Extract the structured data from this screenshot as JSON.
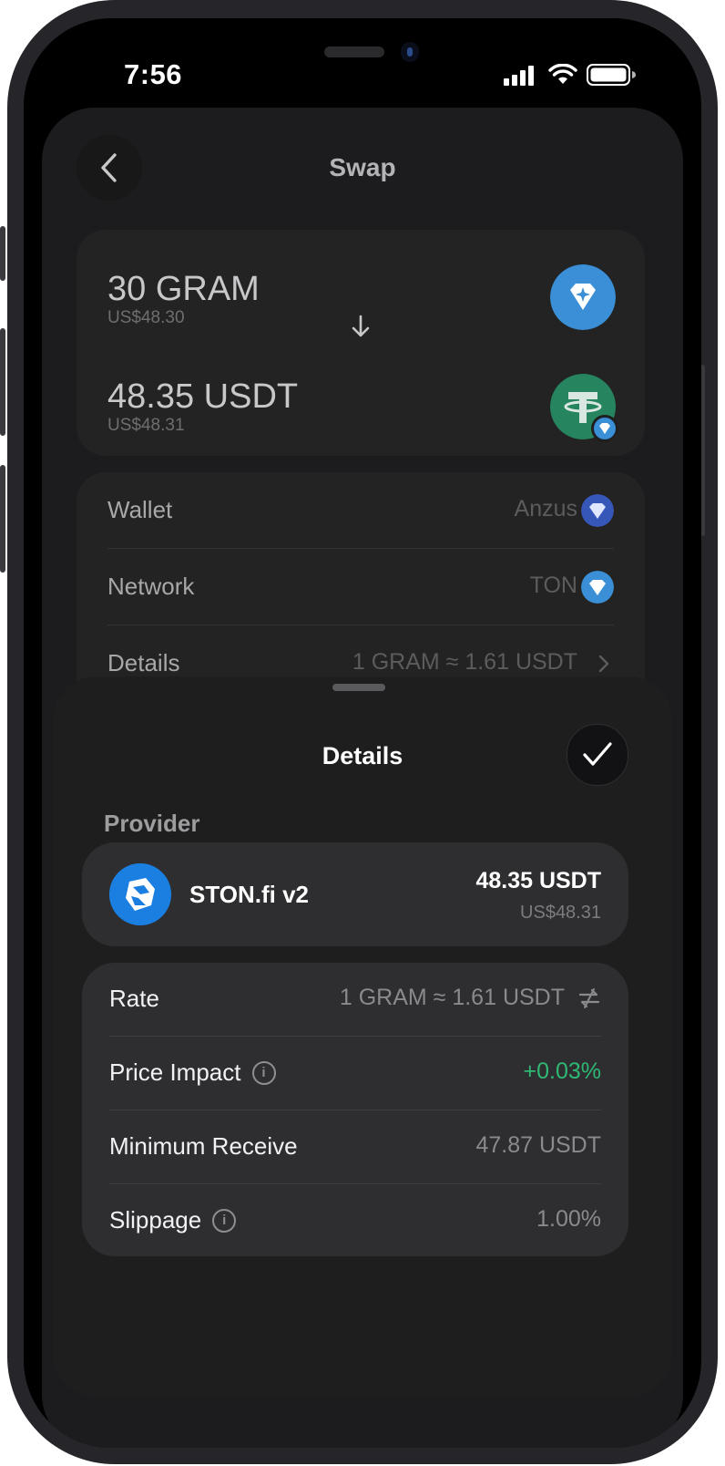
{
  "status_bar": {
    "time": "7:56"
  },
  "header": {
    "title": "Swap"
  },
  "swap": {
    "from": {
      "amount": "30 GRAM",
      "fiat": "US$48.30",
      "icon": "gram-diamond-icon"
    },
    "to": {
      "amount": "48.35 USDT",
      "fiat": "US$48.31",
      "icon": "tether-icon"
    }
  },
  "info": {
    "wallet_label": "Wallet",
    "wallet_value": "Anzus",
    "network_label": "Network",
    "network_value": "TON",
    "details_label": "Details",
    "details_value": "1 GRAM ≈ 1.61 USDT"
  },
  "details_sheet": {
    "title": "Details",
    "provider_section": "Provider",
    "provider": {
      "name": "STON.fi v2",
      "amount": "48.35 USDT",
      "fiat": "US$48.31"
    },
    "params": {
      "rate_label": "Rate",
      "rate_value": "1 GRAM ≈ 1.61 USDT",
      "impact_label": "Price Impact",
      "impact_value": "+0.03%",
      "min_label": "Minimum Receive",
      "min_value": "47.87 USDT",
      "slippage_label": "Slippage",
      "slippage_value": "1.00%"
    },
    "info_glyph": "i"
  },
  "colors": {
    "positive": "#2fb874",
    "ton_blue": "#3a8fd6",
    "tether_green": "#26845f",
    "ston_blue": "#1a7fe0"
  }
}
